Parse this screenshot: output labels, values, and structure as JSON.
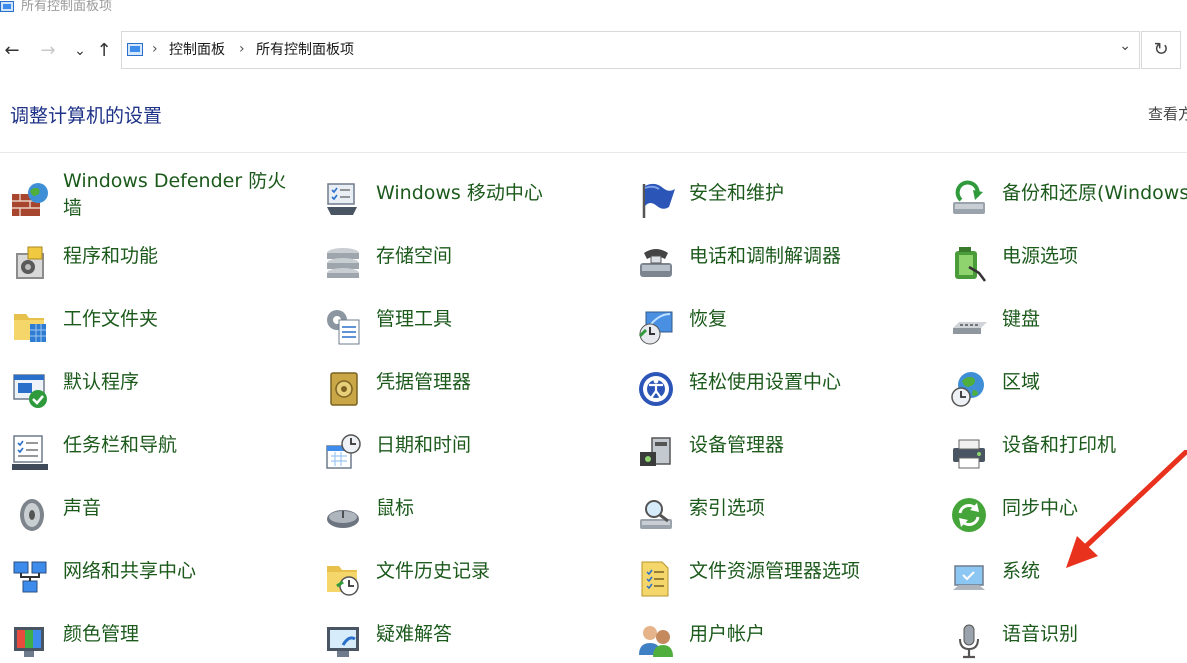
{
  "window": {
    "title": "所有控制面板项"
  },
  "nav": {
    "back_glyph": "←",
    "forward_glyph": "→",
    "recent_glyph": "⌄",
    "up_glyph": "↑",
    "breadcrumb": [
      "控制面板",
      "所有控制面板项"
    ],
    "breadcrumb_sep": "›",
    "dropdown_glyph": "⌄",
    "refresh_glyph": "↻"
  },
  "header": {
    "title": "调整计算机的设置",
    "view_by": "查看方"
  },
  "items": [
    {
      "label": "Windows Defender 防火墙",
      "icon": "firewall-icon"
    },
    {
      "label": "Windows 移动中心",
      "icon": "mobility-center-icon"
    },
    {
      "label": "安全和维护",
      "icon": "security-flag-icon"
    },
    {
      "label": "备份和还原(Windows",
      "icon": "backup-restore-icon"
    },
    {
      "label": "程序和功能",
      "icon": "programs-features-icon"
    },
    {
      "label": "存储空间",
      "icon": "storage-spaces-icon"
    },
    {
      "label": "电话和调制解调器",
      "icon": "phone-modem-icon"
    },
    {
      "label": "电源选项",
      "icon": "power-options-icon"
    },
    {
      "label": "工作文件夹",
      "icon": "work-folders-icon"
    },
    {
      "label": "管理工具",
      "icon": "admin-tools-icon"
    },
    {
      "label": "恢复",
      "icon": "recovery-icon"
    },
    {
      "label": "键盘",
      "icon": "keyboard-icon"
    },
    {
      "label": "默认程序",
      "icon": "default-programs-icon"
    },
    {
      "label": "凭据管理器",
      "icon": "credential-manager-icon"
    },
    {
      "label": "轻松使用设置中心",
      "icon": "ease-of-access-icon"
    },
    {
      "label": "区域",
      "icon": "region-globe-icon"
    },
    {
      "label": "任务栏和导航",
      "icon": "taskbar-icon"
    },
    {
      "label": "日期和时间",
      "icon": "date-time-icon"
    },
    {
      "label": "设备管理器",
      "icon": "device-manager-icon"
    },
    {
      "label": "设备和打印机",
      "icon": "devices-printers-icon"
    },
    {
      "label": "声音",
      "icon": "speaker-icon"
    },
    {
      "label": "鼠标",
      "icon": "mouse-icon"
    },
    {
      "label": "索引选项",
      "icon": "indexing-icon"
    },
    {
      "label": "同步中心",
      "icon": "sync-center-icon"
    },
    {
      "label": "网络和共享中心",
      "icon": "network-icon"
    },
    {
      "label": "文件历史记录",
      "icon": "file-history-icon"
    },
    {
      "label": "文件资源管理器选项",
      "icon": "folder-options-icon"
    },
    {
      "label": "系统",
      "icon": "system-monitor-icon"
    },
    {
      "label": "颜色管理",
      "icon": "color-management-icon"
    },
    {
      "label": "疑难解答",
      "icon": "troubleshooting-icon"
    },
    {
      "label": "用户帐户",
      "icon": "user-accounts-icon"
    },
    {
      "label": "语音识别",
      "icon": "microphone-icon"
    }
  ],
  "colors": {
    "link_green": "#1c5a1c",
    "title_blue": "#1e3287",
    "annotation_red": "#e8321e"
  }
}
